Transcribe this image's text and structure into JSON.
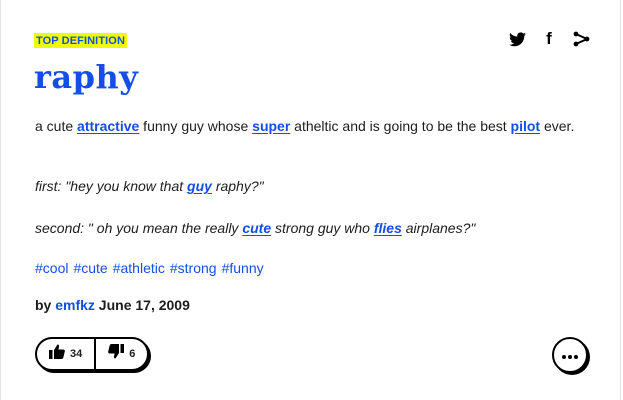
{
  "badge": "TOP DEFINITION",
  "share": {
    "icons": [
      "twitter-icon",
      "facebook-icon",
      "share-icon"
    ],
    "icon_labels": [
      "f"
    ]
  },
  "definition": {
    "word": "raphy",
    "meaning": {
      "t1": "a cute ",
      "l1": "attractive",
      "t2": " funny guy whose ",
      "l2": "super",
      "t3": " atheltic and is going to be the best ",
      "l3": "pilot",
      "t4": " ever."
    },
    "example1": {
      "t1": "first: \"hey you know that ",
      "l1": "guy",
      "t2": " raphy?\""
    },
    "example2": {
      "t1": "second: \" oh you mean the really ",
      "l1": "cute",
      "t2": " strong guy who ",
      "l2": "flies",
      "t3": " airplanes?\""
    },
    "tags": [
      "#cool",
      "#cute",
      "#athletic",
      "#strong",
      "#funny"
    ],
    "author": {
      "prefix": "by ",
      "name": "emfkz",
      "date": " June 17, 2009"
    },
    "votes": {
      "up": "34",
      "down": "6"
    }
  },
  "colors": {
    "accent": "#134fe6",
    "badge_bg": "#efff00",
    "text": "#1d1d1d"
  }
}
